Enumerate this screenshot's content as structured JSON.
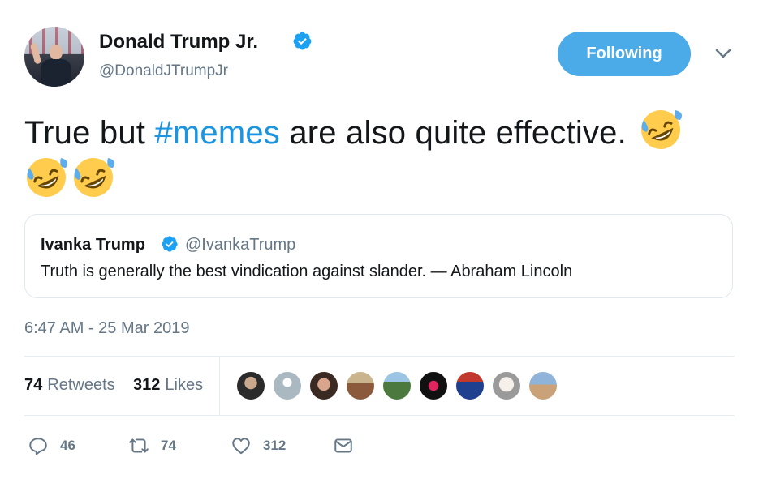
{
  "author": {
    "name": "Donald Trump Jr.",
    "handle": "@DonaldJTrumpJr"
  },
  "follow_button": {
    "label": "Following"
  },
  "tweet": {
    "text_before": "True but ",
    "hashtag": "#memes",
    "text_after": " are also quite effective."
  },
  "quoted_tweet": {
    "name": "Ivanka Trump",
    "handle": "@IvankaTrump",
    "text": "Truth is generally the best vindication against slander.  — Abraham Lincoln"
  },
  "timestamp": "6:47 AM - 25 Mar 2019",
  "stats": {
    "retweets_count": "74",
    "retweets_label": "Retweets",
    "likes_count": "312",
    "likes_label": "Likes"
  },
  "actions": {
    "reply_count": "46",
    "retweet_count": "74",
    "like_count": "312"
  },
  "colors": {
    "accent": "#1b95e0",
    "follow_button": "#4aabe8",
    "secondary_text": "#657786",
    "border": "#e1e8ed"
  },
  "icons": [
    "verified-icon",
    "chevron-down-icon",
    "rofl-emoji",
    "reply-icon",
    "retweet-icon",
    "like-icon",
    "dm-icon"
  ]
}
